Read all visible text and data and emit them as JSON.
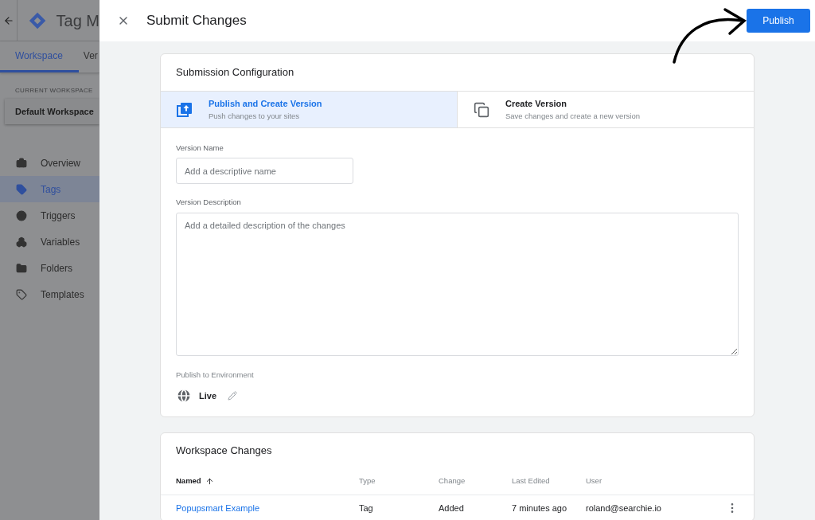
{
  "app": {
    "title": "Tag M"
  },
  "app_tabs": [
    {
      "label": "Workspace",
      "selected": true
    },
    {
      "label": "Ver",
      "selected": false
    }
  ],
  "workspace": {
    "label": "CURRENT WORKSPACE",
    "name": "Default Workspace"
  },
  "nav": [
    {
      "label": "Overview",
      "selected": false
    },
    {
      "label": "Tags",
      "selected": true
    },
    {
      "label": "Triggers",
      "selected": false
    },
    {
      "label": "Variables",
      "selected": false
    },
    {
      "label": "Folders",
      "selected": false
    },
    {
      "label": "Templates",
      "selected": false
    }
  ],
  "dialog": {
    "title": "Submit Changes",
    "primary_button": "Publish"
  },
  "config": {
    "title": "Submission Configuration",
    "options": [
      {
        "title": "Publish and Create Version",
        "subtitle": "Push changes to your sites",
        "selected": true
      },
      {
        "title": "Create Version",
        "subtitle": "Save changes and create a new version",
        "selected": false
      }
    ],
    "version_name": {
      "label": "Version Name",
      "placeholder": "Add a descriptive name"
    },
    "version_description": {
      "label": "Version Description",
      "placeholder": "Add a detailed description of the changes"
    },
    "environment": {
      "label": "Publish to Environment",
      "value": "Live"
    }
  },
  "changes": {
    "title": "Workspace Changes",
    "columns": [
      "Named",
      "Type",
      "Change",
      "Last Edited",
      "User"
    ],
    "rows": [
      {
        "name": "Popupsmart Example",
        "type": "Tag",
        "change": "Added",
        "last_edited": "7 minutes ago",
        "user": "roland@searchie.io"
      }
    ]
  }
}
